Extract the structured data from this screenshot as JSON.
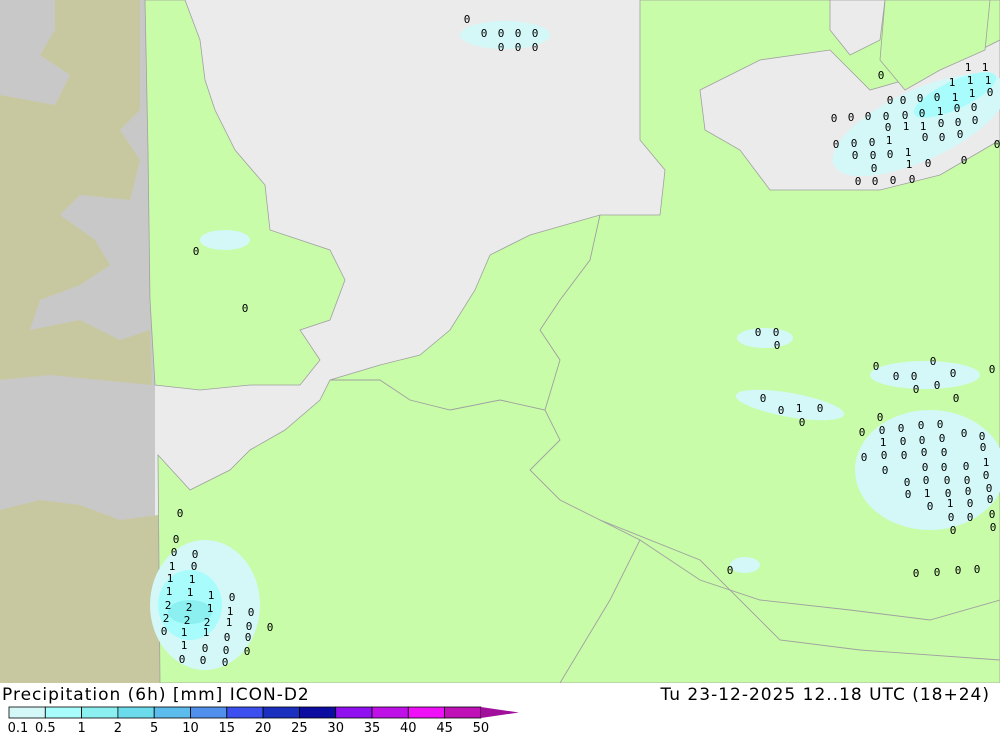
{
  "footer": {
    "left_title": "Precipitation (6h) [mm] ICON-D2",
    "right_title": "Tu 23-12-2025 12..18 UTC (18+24)"
  },
  "legend": {
    "ticks": [
      "0.1",
      "0.5",
      "1",
      "2",
      "5",
      "10",
      "15",
      "20",
      "25",
      "30",
      "35",
      "40",
      "45",
      "50"
    ],
    "colors": [
      "#d4f8f8",
      "#a8fcfc",
      "#8cf0f0",
      "#6cdcec",
      "#5cbcec",
      "#5090ec",
      "#3c50f0",
      "#1c30c0",
      "#0c0ca0",
      "#9010f0",
      "#c010e8",
      "#f010f8",
      "#c010b8"
    ],
    "overflow_color": "#a0109c"
  },
  "map_colors": {
    "land": "#c8fca8",
    "sea": "#ebebeb",
    "outside_sea": "#c8c8c8",
    "outside_land": "#c8c8a0",
    "precip_light": "#d4f8f8",
    "precip_mid": "#a8fcfc",
    "precip_heavy": "#8cf0f0",
    "border": "#a0a0a0"
  },
  "map": {
    "labels": [
      "0",
      "1",
      "1",
      "1",
      "1",
      "1",
      "0",
      "0",
      "0",
      "0",
      "1",
      "1",
      "0",
      "0",
      "0",
      "0",
      "0",
      "0",
      "0",
      "1",
      "0",
      "0",
      "0",
      "1",
      "1",
      "0",
      "0",
      "0",
      "0",
      "0",
      "0",
      "1",
      "0",
      "0",
      "0",
      "0",
      "0",
      "0",
      "0",
      "1",
      "0",
      "1",
      "0",
      "0",
      "0",
      "0",
      "0",
      "0",
      "0",
      "0",
      "0",
      "0",
      "0",
      "0",
      "0",
      "0",
      "0",
      "0",
      "0",
      "0",
      "0",
      "0",
      "0",
      "1",
      "0",
      "0",
      "0",
      "0",
      "0",
      "0",
      "0",
      "0",
      "0",
      "0",
      "0",
      "0",
      "0",
      "0",
      "0",
      "0",
      "0",
      "1",
      "0",
      "0",
      "0",
      "0",
      "0",
      "0",
      "0",
      "0",
      "0",
      "0",
      "0",
      "1",
      "0",
      "0",
      "0",
      "0",
      "0",
      "0",
      "0",
      "0",
      "0",
      "0",
      "0",
      "1",
      "0",
      "0",
      "0",
      "0",
      "1",
      "0",
      "0",
      "0",
      "0",
      "0",
      "0",
      "0",
      "0",
      "0",
      "0",
      "0",
      "0",
      "0",
      "0",
      "0",
      "1",
      "0",
      "1",
      "1",
      "1",
      "1",
      "1",
      "0",
      "2",
      "2",
      "1",
      "1",
      "0",
      "2",
      "2",
      "2",
      "1",
      "0",
      "0",
      "0",
      "1",
      "1",
      "0",
      "0",
      "1",
      "0",
      "0",
      "0",
      "0",
      "0",
      "0"
    ]
  }
}
